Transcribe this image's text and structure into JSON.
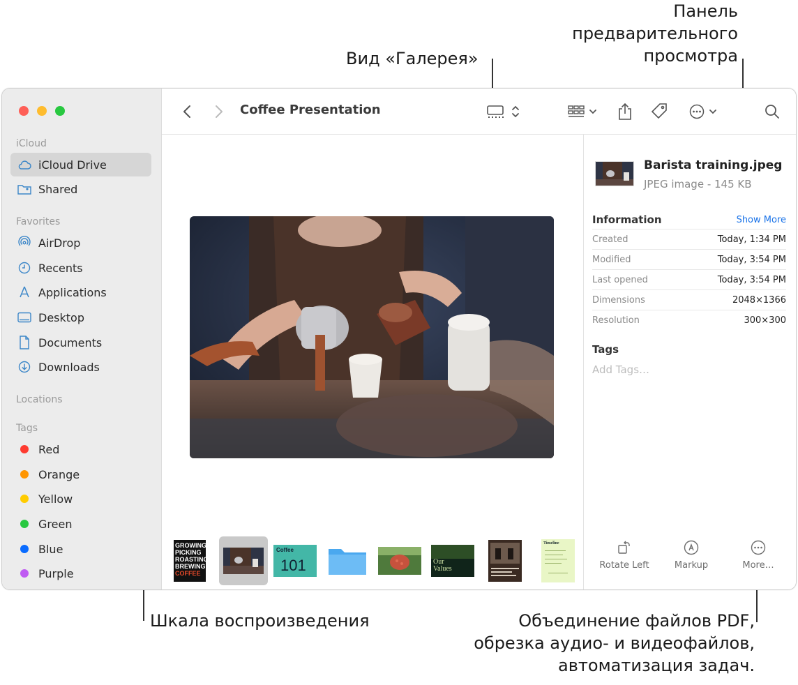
{
  "callouts": {
    "gallery_view": "Вид «Галерея»",
    "preview_pane": [
      "Панель",
      "предварительного",
      "просмотра"
    ],
    "scrubber": "Шкала воспроизведения",
    "more_actions": [
      "Объединение файлов PDF,",
      "обрезка аудио- и видеофайлов,",
      "автоматизация задач."
    ]
  },
  "window": {
    "title": "Coffee Presentation"
  },
  "sidebar": {
    "icloud_section": "iCloud",
    "icloud_items": [
      {
        "label": "iCloud Drive",
        "icon": "cloud-icon",
        "selected": true
      },
      {
        "label": "Shared",
        "icon": "shared-folder-icon",
        "selected": false
      }
    ],
    "favorites_section": "Favorites",
    "favorites_items": [
      {
        "label": "AirDrop",
        "icon": "airdrop-icon"
      },
      {
        "label": "Recents",
        "icon": "clock-icon"
      },
      {
        "label": "Applications",
        "icon": "applications-icon"
      },
      {
        "label": "Desktop",
        "icon": "desktop-icon"
      },
      {
        "label": "Documents",
        "icon": "document-icon"
      },
      {
        "label": "Downloads",
        "icon": "download-icon"
      }
    ],
    "locations_section": "Locations",
    "tags_section": "Tags",
    "tags": [
      {
        "label": "Red",
        "color": "#fe3b30"
      },
      {
        "label": "Orange",
        "color": "#ff9500"
      },
      {
        "label": "Yellow",
        "color": "#ffcc00"
      },
      {
        "label": "Green",
        "color": "#28c840"
      },
      {
        "label": "Blue",
        "color": "#0a6cff"
      },
      {
        "label": "Purple",
        "color": "#bf5af2"
      }
    ]
  },
  "filmstrip": {
    "thumb1_text": [
      "GROWING",
      "PICKING",
      "ROASTING",
      "BREWING",
      "COFFEE"
    ],
    "thumb3_text": [
      "Coffee",
      "101"
    ],
    "thumb6_text": [
      "Our",
      "Values"
    ],
    "thumb8_text": "Timeline"
  },
  "preview": {
    "file_name": "Barista training.jpeg",
    "file_kind": "JPEG image - 145 KB",
    "info_heading": "Information",
    "show_more": "Show More",
    "rows": [
      {
        "key": "Created",
        "value": "Today, 1:34 PM"
      },
      {
        "key": "Modified",
        "value": "Today, 3:54 PM"
      },
      {
        "key": "Last opened",
        "value": "Today, 3:54 PM"
      },
      {
        "key": "Dimensions",
        "value": "2048×1366"
      },
      {
        "key": "Resolution",
        "value": "300×300"
      }
    ],
    "tags_heading": "Tags",
    "tags_placeholder": "Add Tags…",
    "actions": [
      {
        "label": "Rotate Left",
        "icon": "rotate-left-icon"
      },
      {
        "label": "Markup",
        "icon": "markup-icon"
      },
      {
        "label": "More…",
        "icon": "more-icon"
      }
    ]
  }
}
